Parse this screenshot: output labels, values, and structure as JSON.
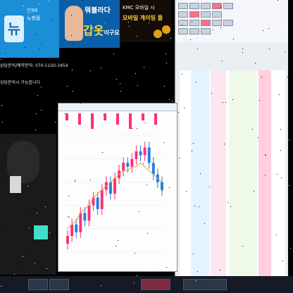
{
  "banner_left": {
    "logo_text": "뉴",
    "line1": "인99",
    "line2": "뉴젠플",
    "line3": ""
  },
  "banner_mid": {
    "headline_top": "뭐볼라다",
    "headline_big": "갑옷",
    "headline_suffix": "이구요"
  },
  "banner_right": {
    "line1": "KMC 모바일 시",
    "line2": "모바일 게이밍 플",
    "line3": ""
  },
  "caption_phone": "상담문의/예약문의: 070-1150-3454",
  "caption_time": "상담문의시 가능합니다",
  "chart": {
    "title": "",
    "accent_up": "#ff2d78",
    "accent_down": "#1e7fe0"
  },
  "chart_data": {
    "type": "candlestick",
    "series": [
      {
        "values": [
          12,
          15,
          13,
          18,
          16,
          20,
          22,
          19,
          24,
          26,
          23,
          27,
          29,
          31,
          30,
          32,
          34,
          33,
          35,
          31,
          28,
          26,
          24
        ]
      }
    ],
    "ma_line": [
      14,
      15,
      16,
      18,
      19,
      20,
      22,
      23,
      24,
      25,
      26,
      27,
      28,
      29,
      29,
      30,
      30,
      31,
      30,
      29,
      28,
      27,
      26
    ]
  },
  "hts": {
    "toolbar_rows": 6
  },
  "colors": {
    "background": "#000000",
    "banner_blue": "#1a8fd6",
    "accent_pink": "#ff6f8a"
  }
}
